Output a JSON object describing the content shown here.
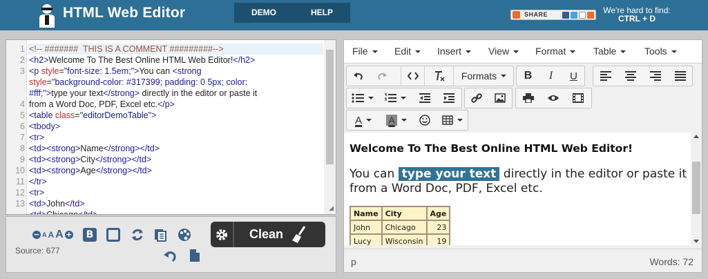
{
  "header": {
    "title": "HTML Web Editor",
    "nav": [
      {
        "label": "DEMO"
      },
      {
        "label": "HELP"
      }
    ],
    "share_label": "SHARE",
    "hard_to_find_line1": "We're hard to find:",
    "hard_to_find_line2": "CTRL + D"
  },
  "code_editor": {
    "line_numbers": [
      "1",
      "2",
      "3",
      "",
      "",
      "4",
      "5",
      "6",
      "7",
      "8",
      "9",
      "10",
      "11",
      "12",
      "13"
    ],
    "lines": [
      [
        {
          "c": "c",
          "t": "<!-- #######  THIS IS A COMMENT #########-->"
        }
      ],
      [
        {
          "c": "t",
          "t": "<h2>"
        },
        {
          "c": "",
          "t": "Welcome To The Best Online HTML Web Editor!"
        },
        {
          "c": "t",
          "t": "</h2>"
        }
      ],
      [
        {
          "c": "t",
          "t": "<p "
        },
        {
          "c": "a",
          "t": "style"
        },
        {
          "c": "",
          "t": "="
        },
        {
          "c": "v",
          "t": "\"font-size: 1.5em;\""
        },
        {
          "c": "t",
          "t": ">"
        },
        {
          "c": "",
          "t": "You can "
        },
        {
          "c": "t",
          "t": "<strong"
        }
      ],
      [
        {
          "c": "a",
          "t": "style"
        },
        {
          "c": "",
          "t": "="
        },
        {
          "c": "v",
          "t": "\"background-color: #317399; padding: 0 5px; color:"
        }
      ],
      [
        {
          "c": "v",
          "t": "#fff;\""
        },
        {
          "c": "t",
          "t": ">"
        },
        {
          "c": "",
          "t": "type your text"
        },
        {
          "c": "t",
          "t": "</strong>"
        },
        {
          "c": "",
          "t": " directly in the editor or paste it"
        }
      ],
      [
        {
          "c": "",
          "t": "from a Word Doc, PDF, Excel etc."
        },
        {
          "c": "t",
          "t": "</p>"
        }
      ],
      [
        {
          "c": "t",
          "t": "<table "
        },
        {
          "c": "a",
          "t": "class"
        },
        {
          "c": "",
          "t": "="
        },
        {
          "c": "v",
          "t": "\"editorDemoTable\""
        },
        {
          "c": "t",
          "t": ">"
        }
      ],
      [
        {
          "c": "t",
          "t": "<tbody>"
        }
      ],
      [
        {
          "c": "t",
          "t": "<tr>"
        }
      ],
      [
        {
          "c": "t",
          "t": "<td><strong>"
        },
        {
          "c": "",
          "t": "Name"
        },
        {
          "c": "t",
          "t": "</strong></td>"
        }
      ],
      [
        {
          "c": "t",
          "t": "<td><strong>"
        },
        {
          "c": "",
          "t": "City"
        },
        {
          "c": "t",
          "t": "</strong></td>"
        }
      ],
      [
        {
          "c": "t",
          "t": "<td><strong>"
        },
        {
          "c": "",
          "t": "Age"
        },
        {
          "c": "t",
          "t": "</strong></td>"
        }
      ],
      [
        {
          "c": "t",
          "t": "</tr>"
        }
      ],
      [
        {
          "c": "t",
          "t": "<tr>"
        }
      ],
      [
        {
          "c": "t",
          "t": "<td>"
        },
        {
          "c": "",
          "t": "John"
        },
        {
          "c": "t",
          "t": "</td>"
        }
      ],
      [
        {
          "c": "t",
          "t": "<td>"
        },
        {
          "c": "",
          "t": "Chicago"
        },
        {
          "c": "t",
          "t": "</td>"
        }
      ]
    ]
  },
  "bottom_toolbar": {
    "font_small": "A",
    "font_mid": "A",
    "font_large": "A",
    "source_label": "Source: 677",
    "clean_label": "Clean"
  },
  "editor": {
    "menu": [
      "File",
      "Edit",
      "Insert",
      "View",
      "Format",
      "Table",
      "Tools"
    ],
    "formats_label": "Formats",
    "content": {
      "heading": "Welcome To The Best Online HTML Web Editor!",
      "p_before": "You can ",
      "p_highlight": "type your text",
      "p_after": " directly in the editor or paste it from a Word Doc, PDF, Excel etc.",
      "table_header": [
        "Name",
        "City",
        "Age"
      ],
      "table_rows": [
        [
          "John",
          "Chicago",
          "23"
        ],
        [
          "Lucy",
          "Wisconsin",
          "19"
        ]
      ]
    },
    "status_path": "p",
    "word_count": "Words: 72"
  },
  "colors": {
    "header_bg": "#2d6f96",
    "nav_bg": "#1d5070",
    "highlight_bg": "#317399",
    "table_bg": "#fdf3c7"
  }
}
